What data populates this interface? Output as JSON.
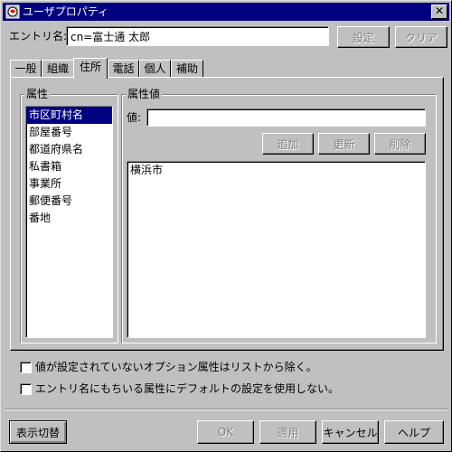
{
  "window": {
    "title": "ユーザプロパティ",
    "close_glyph": "✕",
    "app_icon": "app-icon"
  },
  "entry": {
    "label": "エントリ名:",
    "value": "cn=富士通 太郎",
    "set_button": "設定",
    "clear_button": "クリア"
  },
  "tabs": [
    {
      "label": "一般",
      "active": false
    },
    {
      "label": "組織",
      "active": false
    },
    {
      "label": "住所",
      "active": true
    },
    {
      "label": "電話",
      "active": false
    },
    {
      "label": "個人",
      "active": false
    },
    {
      "label": "補助",
      "active": false
    }
  ],
  "attributes": {
    "group_title": "属性",
    "items": [
      {
        "label": "市区町村名",
        "selected": true
      },
      {
        "label": "部屋番号",
        "selected": false
      },
      {
        "label": "都道府県名",
        "selected": false
      },
      {
        "label": "私書箱",
        "selected": false
      },
      {
        "label": "事業所",
        "selected": false
      },
      {
        "label": "郵便番号",
        "selected": false
      },
      {
        "label": "番地",
        "selected": false
      }
    ]
  },
  "attribute_values": {
    "group_title": "属性値",
    "value_label": "値:",
    "value_input": "",
    "add_button": "追加",
    "update_button": "更新",
    "delete_button": "削除",
    "values": [
      "横浜市"
    ]
  },
  "options": {
    "exclude_unset_optional": {
      "label": "値が設定されていないオプション属性はリストから除く。",
      "checked": false
    },
    "no_default_for_entry_attrs": {
      "label": "エントリ名にもちいる属性にデフォルトの設定を使用しない。",
      "checked": false
    }
  },
  "footer": {
    "toggle_display_button": "表示切替",
    "ok_button": "OK",
    "apply_button": "適用",
    "cancel_button": "キャンセル",
    "help_button": "ヘルプ"
  },
  "colors": {
    "window_bg": "#c0c0c0",
    "titlebar": "#000080",
    "selection": "#000080"
  }
}
